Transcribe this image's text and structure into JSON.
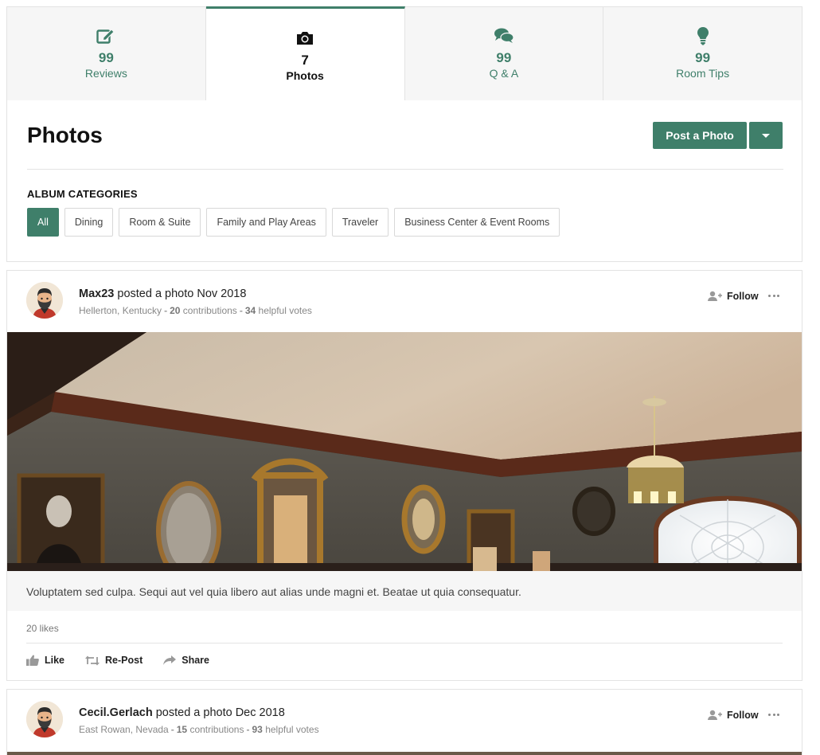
{
  "theme": {
    "accent": "#3f7f6a"
  },
  "tabs": [
    {
      "icon": "edit-icon",
      "count": "99",
      "label": "Reviews",
      "active": false
    },
    {
      "icon": "camera-icon",
      "count": "7",
      "label": "Photos",
      "active": true
    },
    {
      "icon": "comments-icon",
      "count": "99",
      "label": "Q & A",
      "active": false
    },
    {
      "icon": "lightbulb-icon",
      "count": "99",
      "label": "Room Tips",
      "active": false
    }
  ],
  "photos_panel": {
    "title": "Photos",
    "post_button": "Post a Photo",
    "album_heading": "ALBUM CATEGORIES",
    "categories": [
      "All",
      "Dining",
      "Room & Suite",
      "Family and Play Areas",
      "Traveler",
      "Business Center & Event Rooms"
    ],
    "selected_category": "All"
  },
  "posts": [
    {
      "username": "Max23",
      "action": "posted a photo",
      "date": "Nov 2018",
      "location": "Hellerton, Kentucky",
      "contributions": "20",
      "contributions_label": "contributions",
      "votes": "34",
      "votes_label": "helpful votes",
      "follow_label": "Follow",
      "caption": "Voluptatem sed culpa. Sequi aut vel quia libero aut alias unde magni et. Beatae ut quia consequatur.",
      "likes": "20 likes",
      "actions": {
        "like": "Like",
        "repost": "Re-Post",
        "share": "Share"
      }
    },
    {
      "username": "Cecil.Gerlach",
      "action": "posted a photo",
      "date": "Dec 2018",
      "location": "East Rowan, Nevada",
      "contributions": "15",
      "contributions_label": "contributions",
      "votes": "93",
      "votes_label": "helpful votes",
      "follow_label": "Follow"
    }
  ]
}
